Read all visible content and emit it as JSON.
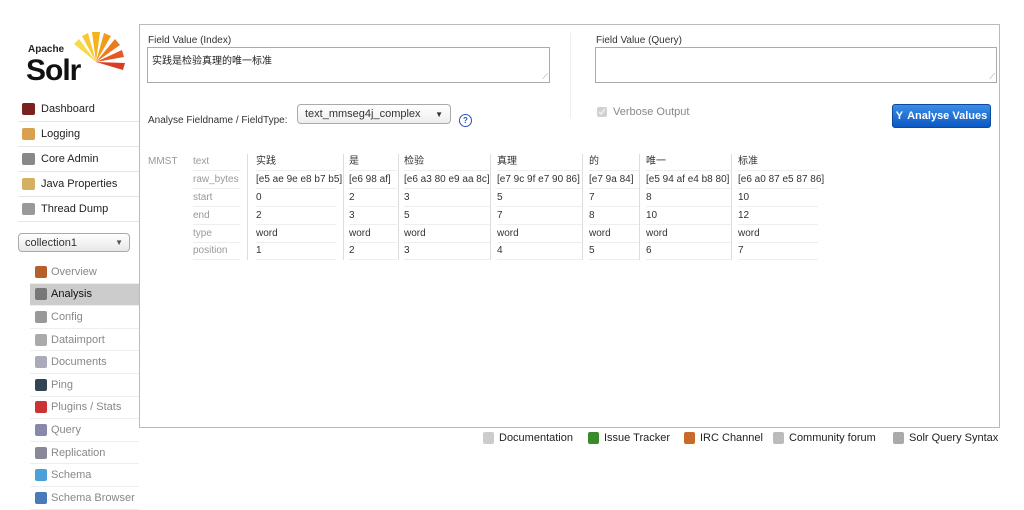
{
  "logo": {
    "apache": "Apache",
    "solr": "Solr"
  },
  "nav": [
    {
      "label": "Dashboard",
      "icon": "dashboard-icon"
    },
    {
      "label": "Logging",
      "icon": "logging-icon"
    },
    {
      "label": "Core Admin",
      "icon": "core-admin-icon"
    },
    {
      "label": "Java Properties",
      "icon": "java-icon"
    },
    {
      "label": "Thread Dump",
      "icon": "thread-dump-icon"
    }
  ],
  "core_selector": "collection1",
  "core_nav": [
    {
      "label": "Overview"
    },
    {
      "label": "Analysis",
      "active": true
    },
    {
      "label": "Config"
    },
    {
      "label": "Dataimport"
    },
    {
      "label": "Documents"
    },
    {
      "label": "Ping"
    },
    {
      "label": "Plugins / Stats"
    },
    {
      "label": "Query"
    },
    {
      "label": "Replication"
    },
    {
      "label": "Schema"
    },
    {
      "label": "Schema Browser"
    }
  ],
  "form": {
    "index_label": "Field Value (Index)",
    "index_value": "实践是检验真理的唯一标准",
    "query_label": "Field Value (Query)",
    "query_value": "",
    "fieldtype_label": "Analyse Fieldname / FieldType:",
    "fieldtype_value": "text_mmseg4j_complex",
    "verbose_label": "Verbose Output",
    "verbose_checked": true,
    "analyse_button": "Analyse Values"
  },
  "analysis": {
    "stage": "MMST",
    "row_names": [
      "text",
      "raw_bytes",
      "start",
      "end",
      "type",
      "position"
    ],
    "tokens": [
      {
        "text": "实践",
        "raw_bytes": "[e5 ae 9e e8 b7 b5]",
        "start": "0",
        "end": "2",
        "type": "word",
        "position": "1"
      },
      {
        "text": "是",
        "raw_bytes": "[e6 98 af]",
        "start": "2",
        "end": "3",
        "type": "word",
        "position": "2"
      },
      {
        "text": "检验",
        "raw_bytes": "[e6 a3 80 e9 aa 8c]",
        "start": "3",
        "end": "5",
        "type": "word",
        "position": "3"
      },
      {
        "text": "真理",
        "raw_bytes": "[e7 9c 9f e7 90 86]",
        "start": "5",
        "end": "7",
        "type": "word",
        "position": "4"
      },
      {
        "text": "的",
        "raw_bytes": "[e7 9a 84]",
        "start": "7",
        "end": "8",
        "type": "word",
        "position": "5"
      },
      {
        "text": "唯一",
        "raw_bytes": "[e5 94 af e4 b8 80]",
        "start": "8",
        "end": "10",
        "type": "word",
        "position": "6"
      },
      {
        "text": "标准",
        "raw_bytes": "[e6 a0 87 e5 87 86]",
        "start": "10",
        "end": "12",
        "type": "word",
        "position": "7"
      }
    ]
  },
  "footer": [
    {
      "label": "Documentation",
      "icon": "document-icon"
    },
    {
      "label": "Issue Tracker",
      "icon": "bug-icon"
    },
    {
      "label": "IRC Channel",
      "icon": "people-icon"
    },
    {
      "label": "Community forum",
      "icon": "mail-icon"
    },
    {
      "label": "Solr Query Syntax",
      "icon": "syntax-icon"
    }
  ],
  "colors": {
    "accent": "#0c58c3",
    "active_nav": "#cccccc"
  }
}
